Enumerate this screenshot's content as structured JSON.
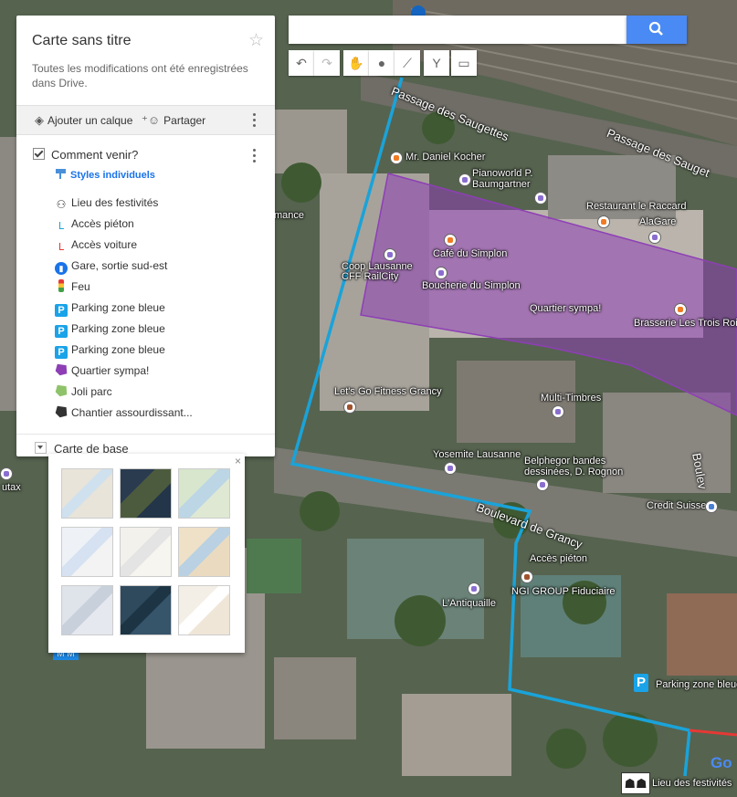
{
  "panel": {
    "title": "Carte sans titre",
    "save_status": "Toutes les modifications ont été enregistrées dans Drive.",
    "add_layer_label": "Ajouter un calque",
    "share_label": "Partager",
    "layer": {
      "name": "Comment venir?",
      "styles_link": "Styles individuels",
      "features": [
        {
          "label": "Lieu des festivités",
          "icon": "people-icon"
        },
        {
          "label": "Accès piéton",
          "icon": "walking-route-icon"
        },
        {
          "label": "Accès voiture",
          "icon": "car-route-icon"
        },
        {
          "label": "Gare, sortie sud-est",
          "icon": "train-icon"
        },
        {
          "label": "Feu",
          "icon": "traffic-light-icon"
        },
        {
          "label": "Parking zone bleue",
          "icon": "parking-icon"
        },
        {
          "label": "Parking zone bleue",
          "icon": "parking-icon"
        },
        {
          "label": "Parking zone bleue",
          "icon": "parking-icon"
        },
        {
          "label": "Quartier sympa!",
          "icon": "polygon-icon"
        },
        {
          "label": "Joli parc",
          "icon": "polygon-icon"
        },
        {
          "label": "Chantier assourdissant...",
          "icon": "polygon-icon"
        }
      ]
    },
    "basemap_label": "Carte de base"
  },
  "basemap_picker": {
    "close": "×",
    "styles": [
      "map-style-thumbnail",
      "satellite-style-thumbnail",
      "terrain-style-thumbnail",
      "light-political-style-thumbnail",
      "mono-city-style-thumbnail",
      "simple-atlas-style-thumbnail",
      "light-landmass-style-thumbnail",
      "dark-landmass-style-thumbnail",
      "whitewater-style-thumbnail"
    ]
  },
  "map": {
    "streets": [
      "Passage des Saugettes",
      "Passage des Sauget",
      "Boulevard de Grancy",
      "Boulev"
    ],
    "pois": [
      "Mr. Daniel Kocher",
      "Pianoworld P. Baumgartner",
      "Restaurant le Raccard",
      "AlaGare",
      "Café du Simplon",
      "Coop Lausanne CFF RailCity",
      "Boucherie du Simplon",
      "Quartier sympa!",
      "Brasserie Les Trois Rois",
      "Let's Go Fitness Grancy",
      "Multi-Timbres",
      "Yosemite Lausanne",
      "Belphegor bandes dessinées, D. Rognon",
      "Credit Suisse",
      "Accès piéton",
      "NGI GROUP Fiduciaire",
      "L'Antiquaille",
      "Parking zone bleue",
      "Lieu des festivités",
      "mance",
      "utax"
    ],
    "google_logo": "Go"
  },
  "colors": {
    "route_blue": "#1aa3d9",
    "route_red": "#e53935",
    "polygon_purple": "#8e3fb5",
    "search_blue": "#4a8af4"
  }
}
